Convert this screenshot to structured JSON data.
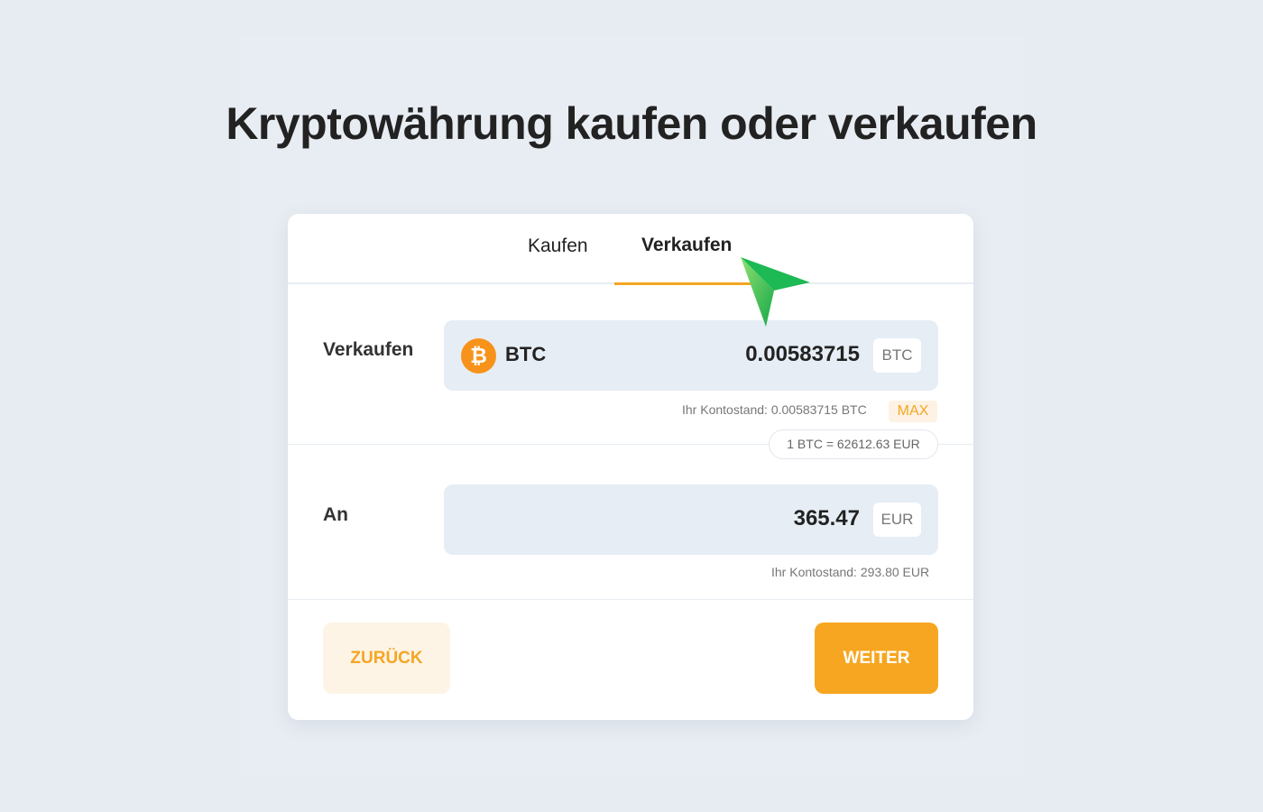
{
  "page": {
    "title": "Kryptowährung kaufen oder verkaufen"
  },
  "tabs": [
    {
      "label": "Kaufen",
      "active": false
    },
    {
      "label": "Verkaufen",
      "active": true
    }
  ],
  "sell_row": {
    "label": "Verkaufen",
    "coin_icon": "bitcoin-icon",
    "coin_icon_glyph": "₿",
    "coin_symbol": "BTC",
    "amount": "0.00583715",
    "unit": "BTC",
    "balance_text": "Ihr Kontostand: 0.00583715 BTC",
    "max_label": "MAX"
  },
  "rate": {
    "text": "1 BTC = 62612.63 EUR"
  },
  "to_row": {
    "label": "An",
    "amount": "365.47",
    "unit": "EUR",
    "balance_text": "Ihr Kontostand: 293.80 EUR"
  },
  "actions": {
    "back_label": "ZURÜCK",
    "next_label": "WEITER"
  },
  "colors": {
    "accent": "#f5a623",
    "bitcoin": "#f7931a",
    "cursor": "#22b14c",
    "background": "#e6ecf2"
  }
}
